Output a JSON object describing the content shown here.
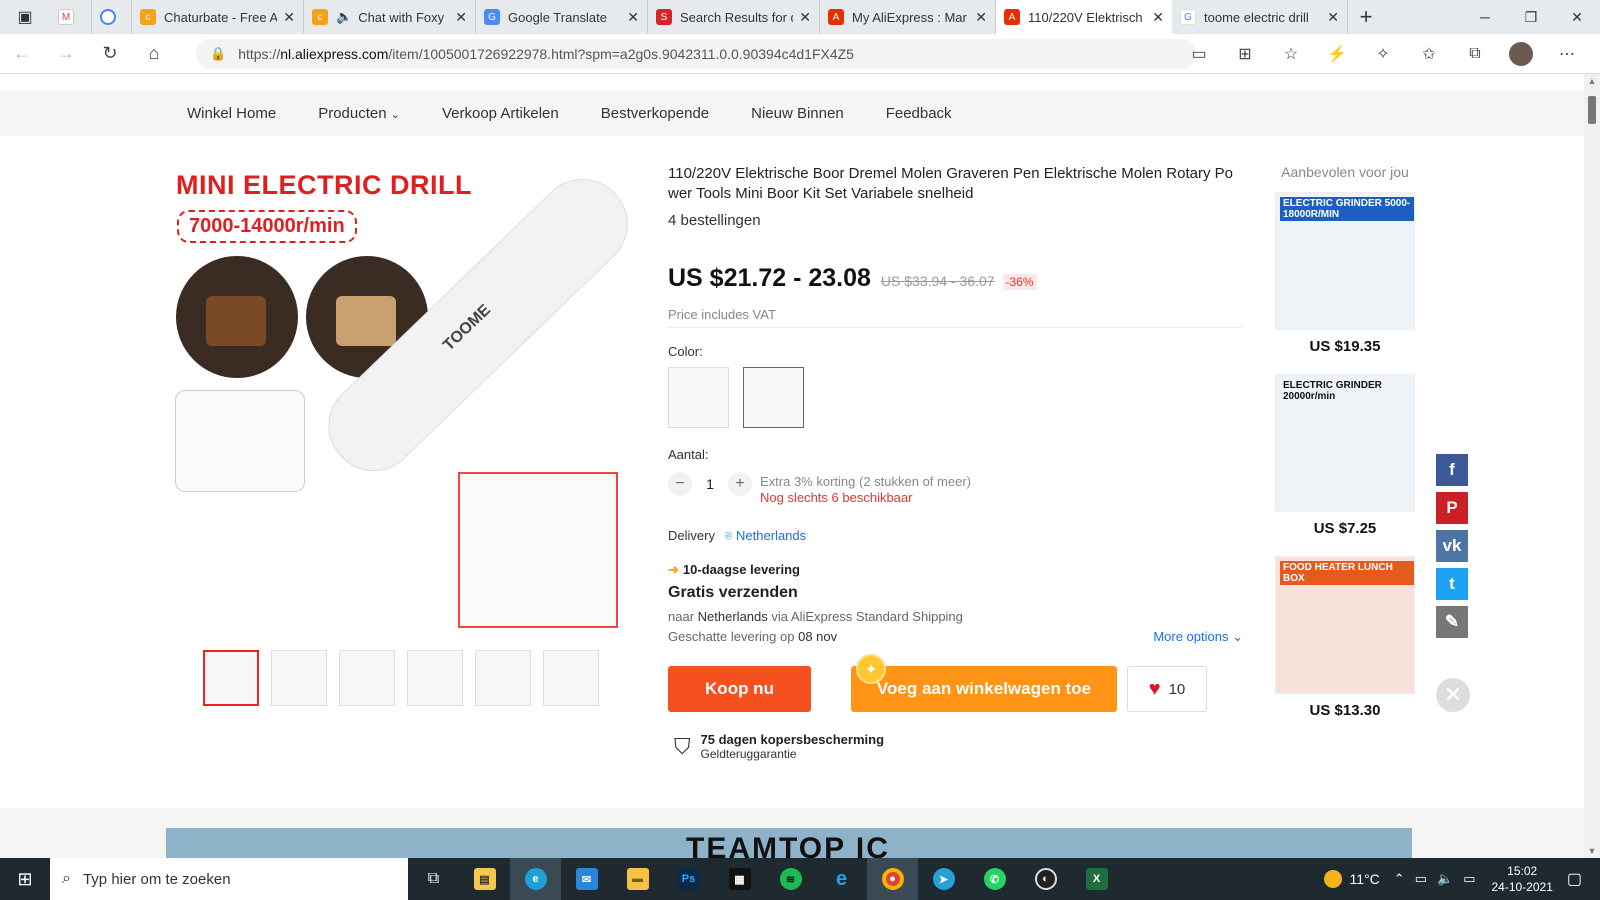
{
  "browser": {
    "tabs": [
      {
        "label": "",
        "icon": "gmail-icon",
        "color": "#ffffff"
      },
      {
        "label": "",
        "icon": "circle-icon",
        "color": "#ffffff"
      },
      {
        "label": "Chaturbate - Free A",
        "icon": "chaturbate-icon",
        "color": "#f4a21b"
      },
      {
        "label": "Chat with Foxy",
        "icon": "chaturbate-icon",
        "color": "#f4a21b"
      },
      {
        "label": "Google Translate",
        "icon": "translate-icon",
        "color": "#4a8af4"
      },
      {
        "label": "Search Results for d",
        "icon": "search-results-icon",
        "color": "#d8232a"
      },
      {
        "label": "My AliExpress : Mar",
        "icon": "aliexpress-icon",
        "color": "#e62e04"
      },
      {
        "label": "110/220V Elektrisch",
        "icon": "aliexpress-icon",
        "color": "#e62e04"
      },
      {
        "label": "toome electric drill",
        "icon": "google-icon",
        "color": "#4285f4"
      }
    ],
    "url_prefix": "https://",
    "url_domain": "nl.aliexpress.com",
    "url_path": "/item/1005001726922978.html?spm=a2g0s.9042311.0.0.90394c4d1FX4Z5"
  },
  "store_nav": [
    "Winkel Home",
    "Producten",
    "Verkoop Artikelen",
    "Bestverkopende",
    "Nieuw Binnen",
    "Feedback"
  ],
  "gallery": {
    "headline": "MINI ELECTRIC DRILL",
    "speed": "7000-14000r/min",
    "brand": "TOOME"
  },
  "product": {
    "title": "110/220V Elektrische Boor Dremel Molen Graveren Pen Elektrische Molen Rotary Po wer Tools Mini Boor Kit Set Variabele snelheid",
    "orders": "4 bestellingen",
    "price": "US $21.72 - 23.08",
    "old_price": "US $33.94 - 36.07",
    "discount": "-36%",
    "vat": "Price includes VAT",
    "color_label": "Color:",
    "qty_label": "Aantal:",
    "qty_value": "1",
    "qty_minus": "−",
    "qty_plus": "+",
    "qty_note": "Extra 3% korting (2 stukken of meer)",
    "stock_note": "Nog slechts 6 beschikbaar",
    "delivery_label": "Delivery",
    "delivery_country": "Netherlands",
    "fast_delivery": "10-daagse levering",
    "free_shipping": "Gratis verzenden",
    "ship_to": "naar",
    "ship_country": "Netherlands",
    "ship_via": "via AliExpress Standard Shipping",
    "eta_label": "Geschatte levering op",
    "eta_date": "08 nov",
    "more_options": "More options",
    "buy_now": "Koop nu",
    "add_to_cart": "Voeg aan winkelwagen toe",
    "wishlist_count": "10",
    "protection": "75 dagen kopersbescherming",
    "guarantee": "Geldteruggarantie"
  },
  "recommended": {
    "title": "Aanbevolen voor jou",
    "items": [
      {
        "price": "US $19.35",
        "tag": "ELECTRIC GRINDER 5000-18000R/MIN"
      },
      {
        "price": "US $7.25",
        "tag": "ELECTRIC GRINDER 20000r/min"
      },
      {
        "price": "US $13.30",
        "tag": "FOOD HEATER LUNCH BOX"
      }
    ]
  },
  "banner_text": "TEAMTOP IC",
  "taskbar": {
    "search_placeholder": "Typ hier om te zoeken",
    "temperature": "11°C",
    "time": "15:02",
    "date": "24-10-2021"
  },
  "colors": {
    "buy_button": "#f4511e",
    "cart_button": "#ff9416",
    "price_red": "#e33333",
    "link_blue": "#1a6fe0",
    "facebook": "#3b5998",
    "pinterest": "#cb2027",
    "vk": "#4c75a3",
    "twitter": "#1da1f2"
  }
}
